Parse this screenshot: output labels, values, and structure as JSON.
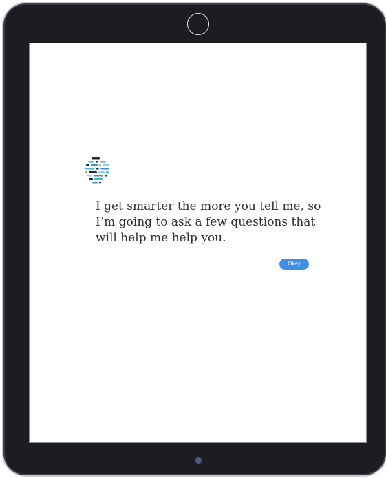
{
  "dialog": {
    "message": "I get smarter the more you tell me, so\nI’m going to ask a few questions that\nwill help me help you.",
    "okay_label": "Okay"
  },
  "icons": {
    "camera": "front-camera-icon",
    "home": "home-button-icon",
    "logo": "assistant-logo-icon"
  },
  "colors": {
    "device_frame": "#1b1d20",
    "screen_background": "#ffffff",
    "message_text": "#2a2f36",
    "okay_button": "#3d8fe8",
    "logo_teal": "#35c3c8",
    "logo_navy": "#1f2a44",
    "logo_blue": "#3c8fe0",
    "logo_orange": "#f08a3a",
    "logo_light_blue": "#8fd3f4"
  }
}
